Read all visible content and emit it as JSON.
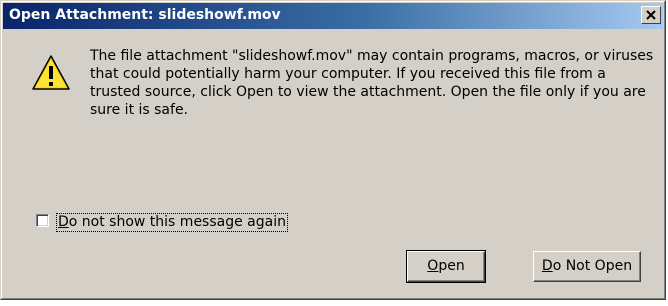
{
  "window": {
    "title": "Open Attachment: slideshowf.mov"
  },
  "icons": {
    "warning": "warning-triangle-icon",
    "close": "close-icon"
  },
  "message": {
    "lines": [
      "The file attachment \"slideshowf.mov\" may contain programs, macros, or viruses",
      "that could potentially harm your computer. If you received this file from a",
      "trusted source, click Open to view the attachment. Open the file only if you are",
      "sure it is safe."
    ]
  },
  "checkbox": {
    "label_first": "D",
    "label_rest": "o not show this message again",
    "checked": false
  },
  "buttons": {
    "open_first": "O",
    "open_rest": "pen",
    "donotopen_first": "D",
    "donotopen_rest": "o Not Open"
  },
  "colors": {
    "titlebar_start": "#0a246a",
    "titlebar_end": "#a6caf0",
    "face": "#d4d0c8",
    "warning_yellow": "#ffd700"
  }
}
